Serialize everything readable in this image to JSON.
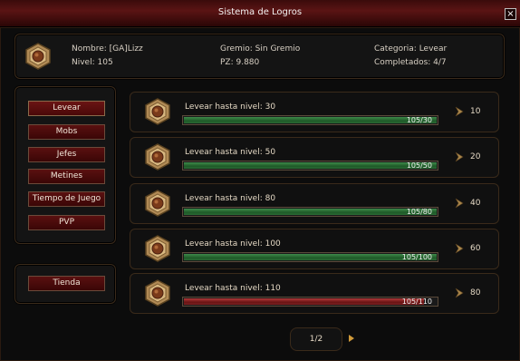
{
  "window": {
    "title": "Sistema de Logros",
    "close_label": "×"
  },
  "profile": {
    "nombre": "Nombre: [GA]Lizz",
    "nivel": "Nivel: 105",
    "gremio": "Gremio: Sin Gremio",
    "pz": "PZ: 9.880",
    "categoria": "Categoria: Levear",
    "completados": "Completados: 4/7",
    "icon": "achievement-medal-icon"
  },
  "categories": [
    {
      "label": "Levear",
      "active": true
    },
    {
      "label": "Mobs"
    },
    {
      "label": "Jefes"
    },
    {
      "label": "Metines"
    },
    {
      "label": "Tiempo de Juego"
    },
    {
      "label": "PVP"
    }
  ],
  "shop": {
    "label": "Tienda"
  },
  "achievements": [
    {
      "name": "Levear hasta nivel: 30",
      "progress_text": "105/30",
      "progress": 1.0,
      "points": "10",
      "color": "#2f7a3a"
    },
    {
      "name": "Levear hasta nivel: 50",
      "progress_text": "105/50",
      "progress": 1.0,
      "points": "20",
      "color": "#2f7a3a"
    },
    {
      "name": "Levear hasta nivel: 80",
      "progress_text": "105/80",
      "progress": 1.0,
      "points": "40",
      "color": "#2f7a3a"
    },
    {
      "name": "Levear hasta nivel: 100",
      "progress_text": "105/100",
      "progress": 1.0,
      "points": "60",
      "color": "#2f7a3a"
    },
    {
      "name": "Levear hasta nivel: 110",
      "progress_text": "105/110",
      "progress": 0.95,
      "points": "80",
      "color": "#8a2222"
    }
  ],
  "pager": {
    "label": "1/2"
  }
}
